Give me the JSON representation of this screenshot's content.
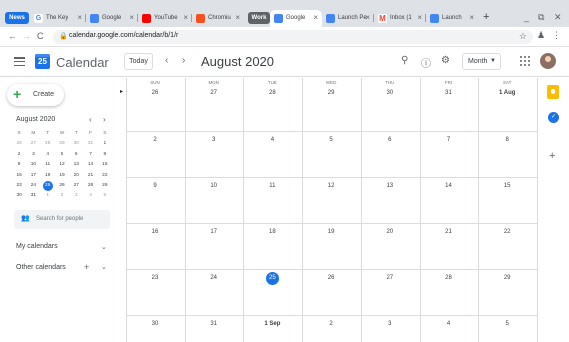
{
  "browser": {
    "groups": [
      {
        "label": "News",
        "color": "#1a73e8"
      },
      {
        "label": "Work",
        "color": "#5f6368"
      }
    ],
    "tabs": [
      {
        "title": "The Key",
        "icon": "google-g-icon",
        "color": "#ffffff"
      },
      {
        "title": "Google",
        "icon": "google-news-icon",
        "color": "#4285f4"
      },
      {
        "title": "YouTube",
        "icon": "youtube-icon",
        "color": "#ff0000"
      },
      {
        "title": "Chromiu",
        "icon": "chromium-icon",
        "color": "#f4511e"
      },
      {
        "title": "Google",
        "icon": "google-calendar-icon",
        "color": "#4285f4",
        "active": true
      },
      {
        "title": "Launch Pe",
        "icon": "docs-icon",
        "color": "#4285f4"
      },
      {
        "title": "Inbox (1",
        "icon": "gmail-icon",
        "color": "#ea4335"
      },
      {
        "title": "Launch",
        "icon": "docs-icon",
        "color": "#4285f4"
      }
    ],
    "new_tab": "+",
    "url": "calendar.google.com/calendar/b/1/r"
  },
  "header": {
    "app_name": "Calendar",
    "logo_text": "25",
    "today_label": "Today",
    "month_title": "August 2020",
    "view_label": "Month"
  },
  "sidebar": {
    "create_label": "Create",
    "mini_title": "August 2020",
    "mini_dow": [
      "S",
      "M",
      "T",
      "W",
      "T",
      "F",
      "S"
    ],
    "mini_weeks": [
      [
        "26",
        "27",
        "28",
        "29",
        "30",
        "31",
        "1"
      ],
      [
        "2",
        "3",
        "4",
        "5",
        "6",
        "7",
        "8"
      ],
      [
        "9",
        "10",
        "11",
        "12",
        "13",
        "14",
        "15"
      ],
      [
        "16",
        "17",
        "18",
        "19",
        "20",
        "21",
        "22"
      ],
      [
        "23",
        "24",
        "25",
        "26",
        "27",
        "28",
        "29"
      ],
      [
        "30",
        "31",
        "1",
        "2",
        "3",
        "4",
        "5"
      ]
    ],
    "search_people": "Search for people",
    "my_calendars": "My calendars",
    "other_calendars": "Other calendars"
  },
  "month": {
    "dow": [
      "SUN",
      "MON",
      "TUE",
      "WED",
      "THU",
      "FRI",
      "SAT"
    ],
    "weeks": [
      [
        "26",
        "27",
        "28",
        "29",
        "30",
        "31",
        "1 Aug"
      ],
      [
        "2",
        "3",
        "4",
        "5",
        "6",
        "7",
        "8"
      ],
      [
        "9",
        "10",
        "11",
        "12",
        "13",
        "14",
        "15"
      ],
      [
        "16",
        "17",
        "18",
        "19",
        "20",
        "21",
        "22"
      ],
      [
        "23",
        "24",
        "25",
        "26",
        "27",
        "28",
        "29"
      ],
      [
        "30",
        "31",
        "1 Sep",
        "2",
        "3",
        "4",
        "5"
      ]
    ],
    "today": "25"
  },
  "colors": {
    "accent": "#1a73e8",
    "create_plus": "#34a853",
    "keep": "#fbbc04"
  }
}
